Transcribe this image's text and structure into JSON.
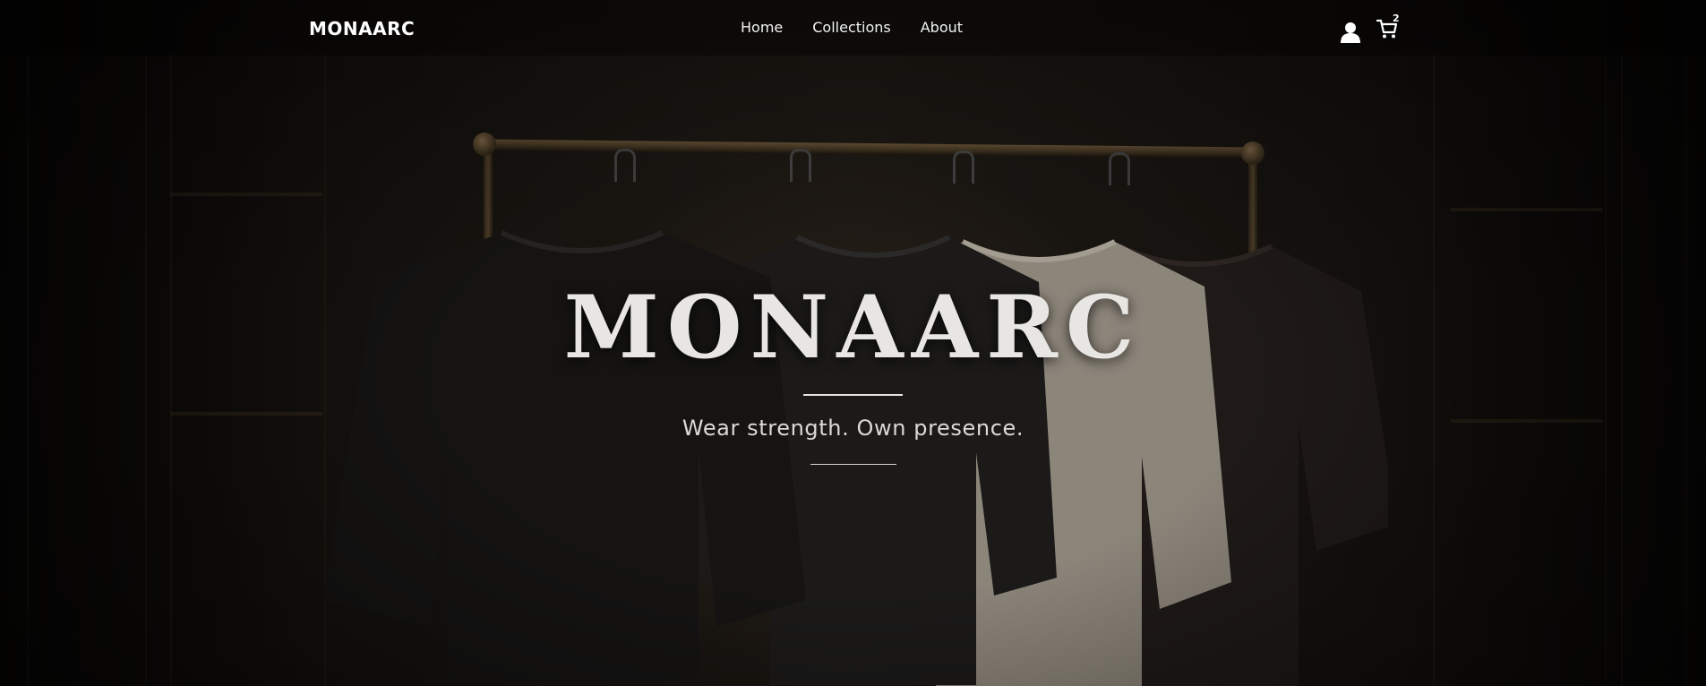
{
  "brand": {
    "logo_text": "MONAARC"
  },
  "nav": {
    "items": [
      {
        "label": "Home"
      },
      {
        "label": "Collections"
      },
      {
        "label": "About"
      }
    ]
  },
  "header_actions": {
    "user_icon": "user-icon",
    "cart_icon": "cart-icon",
    "cart_count": "2"
  },
  "hero": {
    "title": "MONAARC",
    "tagline": "Wear strength. Own presence.",
    "image_subject": "four t-shirts on hangers on a bronze clothing rack",
    "shirt_colors": [
      "#151413",
      "#1b1a19",
      "#8f887c",
      "#1f1a18"
    ]
  },
  "colors": {
    "background": "#0b0908",
    "text_primary": "#ffffff",
    "hero_title": "#e8e6e3",
    "rack_bronze": "#4c3d28"
  }
}
